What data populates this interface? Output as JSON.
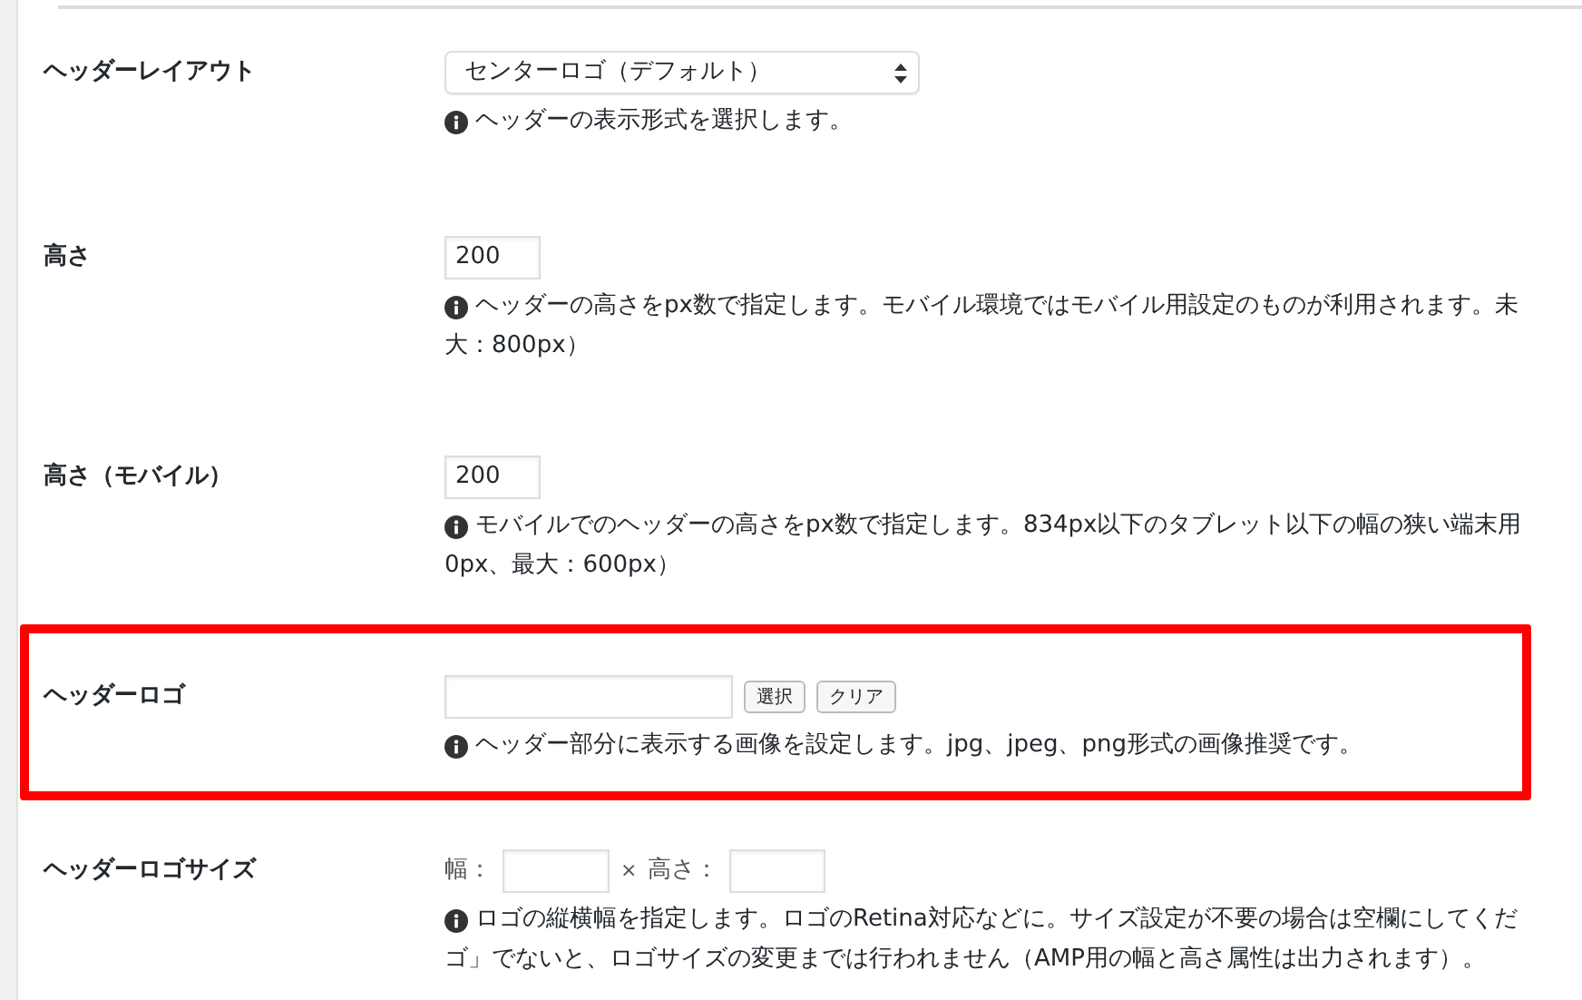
{
  "rows": [
    {
      "kind": "select",
      "label": "ヘッダーレイアウト",
      "value": "センターロゴ（デフォルト）",
      "help": [
        "ヘッダーの表示形式を選択します。"
      ],
      "highlighted": false
    },
    {
      "kind": "text",
      "label": "高さ",
      "value": "200",
      "help": [
        "ヘッダーの高さをpx数で指定します。モバイル環境ではモバイル用設定のものが利用されます。未",
        "大：800px）"
      ],
      "highlighted": false
    },
    {
      "kind": "text",
      "label": "高さ（モバイル）",
      "value": "200",
      "help": [
        "モバイルでのヘッダーの高さをpx数で指定します。834px以下のタブレット以下の幅の狭い端末用",
        "0px、最大：600px）"
      ],
      "highlighted": false
    },
    {
      "kind": "image",
      "label": "ヘッダーロゴ",
      "buttons": [
        "選択",
        "クリア"
      ],
      "help": [
        "ヘッダー部分に表示する画像を設定します。jpg、jpeg、png形式の画像推奨です。"
      ],
      "highlighted": true
    },
    {
      "kind": "size",
      "label": "ヘッダーロゴサイズ",
      "width_label": "幅：",
      "times": "×",
      "height_label": "高さ：",
      "help": [
        "ロゴの縦横幅を指定します。ロゴのRetina対応などに。サイズ設定が不要の場合は空欄にしてくだ",
        "ゴ」でないと、ロゴサイズの変更までは行われません（AMP用の幅と高さ属性は出力されます）。"
      ],
      "highlighted": false
    }
  ]
}
